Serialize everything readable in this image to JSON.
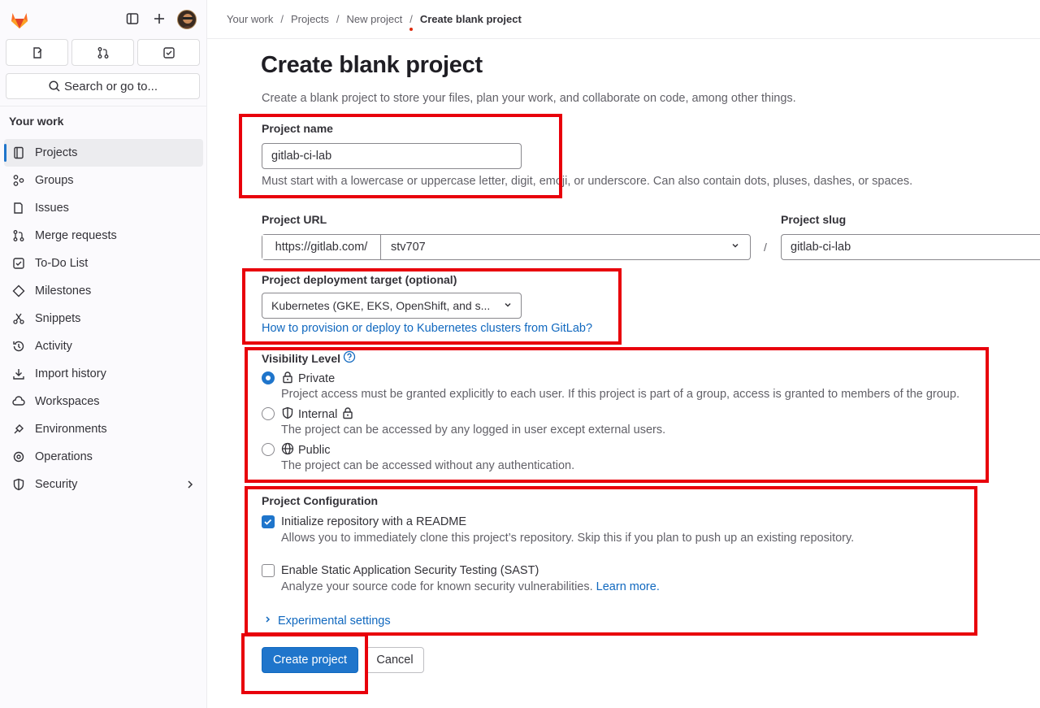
{
  "sidebar": {
    "section_title": "Your work",
    "search_label": "Search or go to...",
    "items": [
      {
        "label": "Projects",
        "icon": "project-icon",
        "active": true
      },
      {
        "label": "Groups",
        "icon": "group-icon"
      },
      {
        "label": "Issues",
        "icon": "issues-icon"
      },
      {
        "label": "Merge requests",
        "icon": "merge-request-icon"
      },
      {
        "label": "To-Do List",
        "icon": "todo-icon"
      },
      {
        "label": "Milestones",
        "icon": "milestone-icon"
      },
      {
        "label": "Snippets",
        "icon": "snippet-icon"
      },
      {
        "label": "Activity",
        "icon": "history-icon"
      },
      {
        "label": "Import history",
        "icon": "import-icon"
      },
      {
        "label": "Workspaces",
        "icon": "workspace-icon"
      },
      {
        "label": "Environments",
        "icon": "environment-icon"
      },
      {
        "label": "Operations",
        "icon": "operations-icon"
      },
      {
        "label": "Security",
        "icon": "shield-icon"
      }
    ]
  },
  "breadcrumb": [
    "Your work",
    "Projects",
    "New project",
    "Create blank project"
  ],
  "page": {
    "title": "Create blank project",
    "subtitle": "Create a blank project to store your files, plan your work, and collaborate on code, among other things."
  },
  "form": {
    "project_name_label": "Project name",
    "project_name_value": "gitlab-ci-lab",
    "project_name_help": "Must start with a lowercase or uppercase letter, digit, emoji, or underscore. Can also contain dots, pluses, dashes, or spaces.",
    "project_url_label": "Project URL",
    "project_url_prefix": "https://gitlab.com/",
    "project_url_namespace": "stv707",
    "url_separator": "/",
    "project_slug_label": "Project slug",
    "project_slug_value": "gitlab-ci-lab",
    "deployment_label": "Project deployment target (optional)",
    "deployment_value": "Kubernetes (GKE, EKS, OpenShift, and s...",
    "deployment_link": "How to provision or deploy to Kubernetes clusters from GitLab?",
    "visibility_label": "Visibility Level",
    "visibility_options": [
      {
        "label": "Private",
        "help": "Project access must be granted explicitly to each user. If this project is part of a group, access is granted to members of the group.",
        "checked": true
      },
      {
        "label": "Internal",
        "help": "The project can be accessed by any logged in user except external users.",
        "checked": false
      },
      {
        "label": "Public",
        "help": "The project can be accessed without any authentication.",
        "checked": false
      }
    ],
    "config_label": "Project Configuration",
    "readme_label": "Initialize repository with a README",
    "readme_help": "Allows you to immediately clone this project’s repository. Skip this if you plan to push up an existing repository.",
    "readme_checked": true,
    "sast_label": "Enable Static Application Security Testing (SAST)",
    "sast_help": "Analyze your source code for known security vulnerabilities.",
    "sast_link": "Learn more.",
    "sast_checked": false,
    "experimental_label": "Experimental settings",
    "create_button": "Create project",
    "cancel_button": "Cancel"
  },
  "colors": {
    "accent": "#1f75cb",
    "link": "#1068bf",
    "highlight": "#e8000b"
  }
}
